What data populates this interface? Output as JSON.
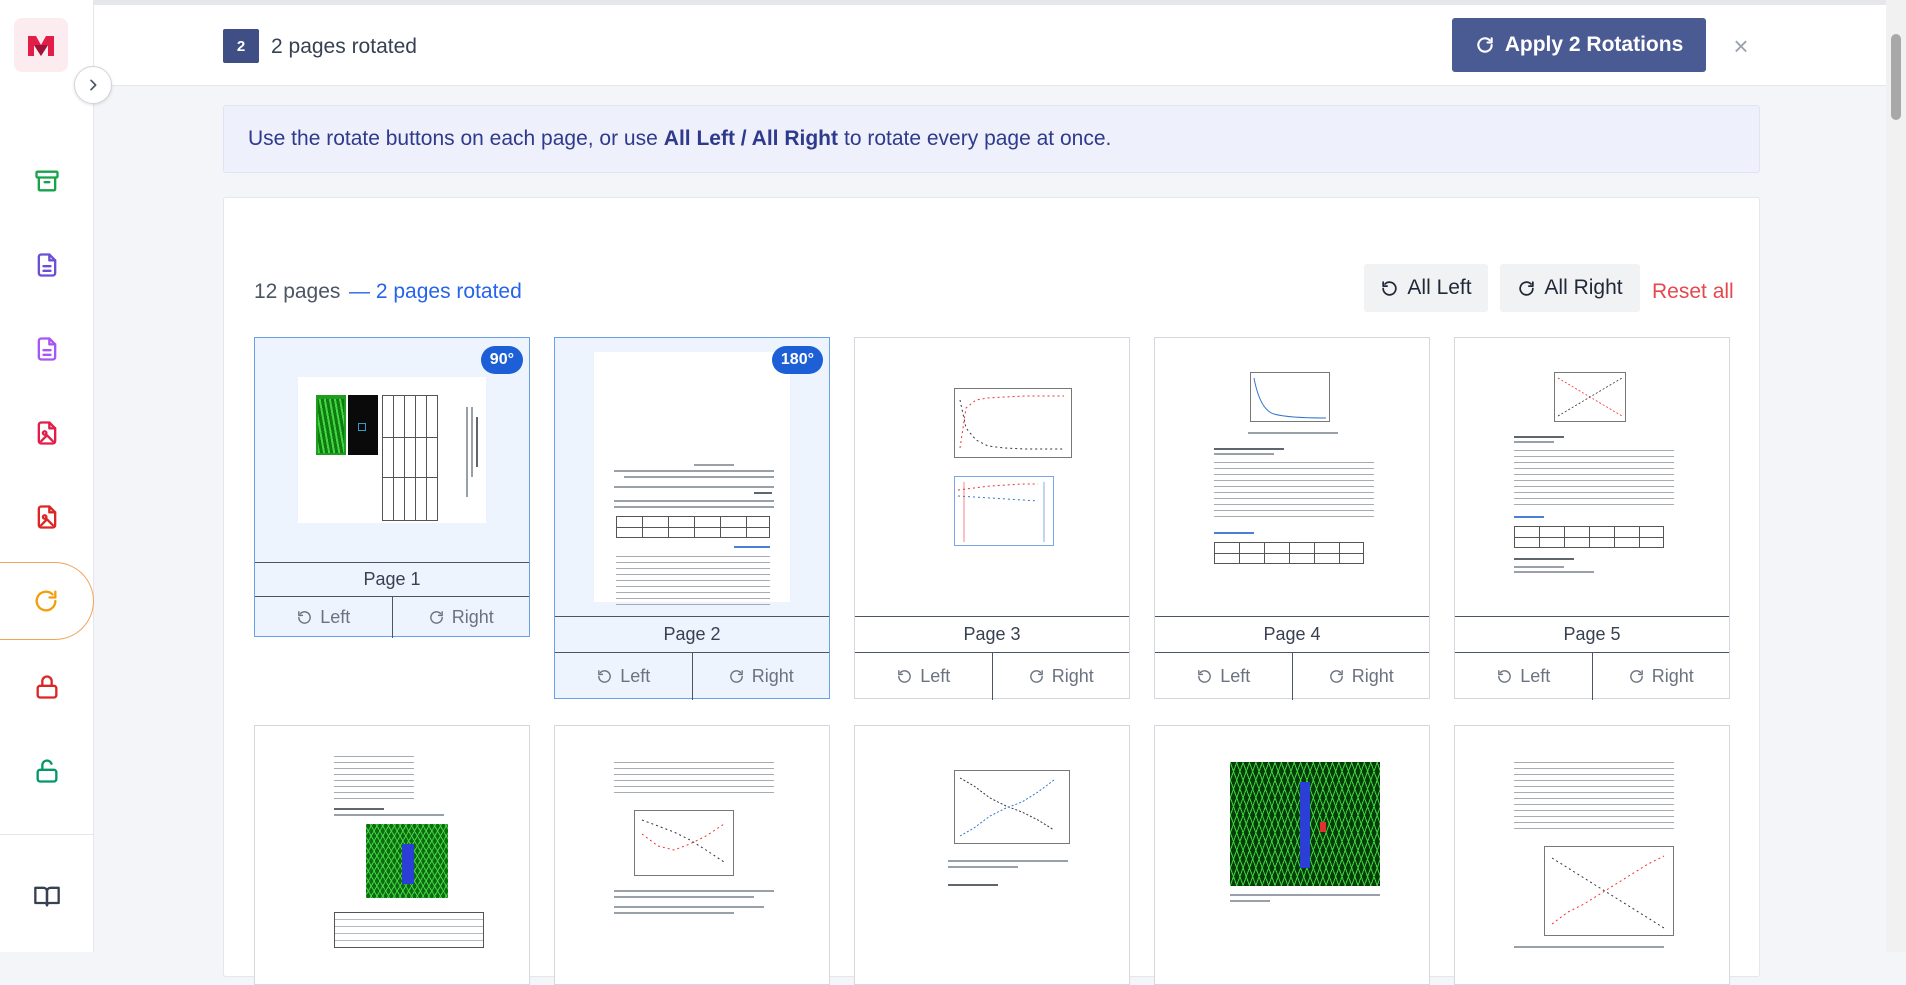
{
  "header": {
    "badge_count": "2",
    "rotated_text": "2 pages rotated",
    "apply_label": "Apply 2 Rotations",
    "close_symbol": "×"
  },
  "banner": {
    "text_before": "Use the rotate buttons on each page, or use",
    "bold_text": "All Left / All Right",
    "text_after": "to rotate every page at once."
  },
  "card": {
    "pages_count": "12 pages",
    "pages_rotated": "— 2 pages rotated",
    "all_left_label": "All Left",
    "all_right_label": "All Right",
    "reset_all_label": "Reset all"
  },
  "tiles": [
    {
      "label": "Page 1",
      "badge": "90°",
      "left": "Left",
      "right": "Right"
    },
    {
      "label": "Page 2",
      "badge": "180°",
      "left": "Left",
      "right": "Right"
    },
    {
      "label": "Page 3",
      "left": "Left",
      "right": "Right"
    },
    {
      "label": "Page 4",
      "left": "Left",
      "right": "Right"
    },
    {
      "label": "Page 5",
      "left": "Left",
      "right": "Right"
    }
  ],
  "sidebar": {
    "items": [
      {
        "icon": "archive-icon",
        "color": "#16a34a"
      },
      {
        "icon": "document-icon",
        "color": "#6d4fd6"
      },
      {
        "icon": "document-icon",
        "color": "#a855f7"
      },
      {
        "icon": "image-file-icon",
        "color": "#e11d48"
      },
      {
        "icon": "image-file-icon",
        "color": "#dc2626"
      },
      {
        "icon": "rotate-icon",
        "color": "#f59e0b"
      },
      {
        "icon": "lock-icon",
        "color": "#dc2626"
      },
      {
        "icon": "unlock-icon",
        "color": "#059669"
      },
      {
        "icon": "book-icon",
        "color": "#374151"
      }
    ]
  },
  "colors": {
    "accent": "#4a5a92",
    "link_blue": "#2563eb",
    "reset_red": "#e5484d",
    "badge_blue": "#1d5fd6"
  }
}
